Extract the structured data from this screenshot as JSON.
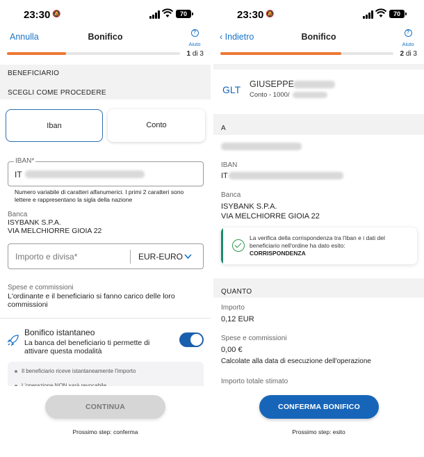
{
  "status": {
    "time": "23:30",
    "battery": "70"
  },
  "left": {
    "nav": {
      "left": "Annulla",
      "title": "Bonifico",
      "help": "Aiuto"
    },
    "progress": {
      "fraction": 0.34,
      "step": "1",
      "of": "di 3"
    },
    "beneficiario_label": "BENEFICIARIO",
    "choose_label": "SCEGLI COME PROCEDERE",
    "options": [
      {
        "label": "Iban",
        "selected": true
      },
      {
        "label": "Conto",
        "selected": false
      }
    ],
    "iban": {
      "label": "IBAN*",
      "prefix": "IT",
      "hint": "Numero variabile di caratteri alfanumerici. I primi 2 caratteri sono lettere e rappresentano la sigla della nazione"
    },
    "banca": {
      "label": "Banca",
      "name": "ISYBANK S.P.A.",
      "address": "VIA MELCHIORRE GIOIA 22"
    },
    "amount": {
      "placeholder": "Importo e divisa*",
      "currency": "EUR-EURO"
    },
    "spese": {
      "label": "Spese e commissioni",
      "text": "L'ordinante e il beneficiario si fanno carico delle loro commissioni"
    },
    "instant": {
      "title": "Bonifico istantaneo",
      "text": "La banca del beneficiario ti permette di attivare questa modalità",
      "on": true
    },
    "bullets": [
      "Il beneficiario riceve istantaneamente l'importo",
      "L'operazione NON sarà revocabile"
    ],
    "button": "CONTINUA",
    "next_step": "Prossimo step: conferma"
  },
  "right": {
    "nav": {
      "left": "Indietro",
      "title": "Bonifico",
      "help": "Aiuto"
    },
    "progress": {
      "fraction": 0.7,
      "step": "2",
      "of": "di 3"
    },
    "recipient": {
      "initials": "GLT",
      "name": "GIUSEPPE",
      "account_prefix": "Conto - 1000/"
    },
    "a_label": "A",
    "iban": {
      "label": "IBAN",
      "prefix": "IT"
    },
    "banca": {
      "label": "Banca",
      "name": "ISYBANK S.P.A.",
      "address": "VIA MELCHIORRE GIOIA 22"
    },
    "verify": {
      "text": "La verifica della corrispondenza tra l'iban e i dati del beneficiario nell'ordine ha dato esito:",
      "result": "CORRISPONDENZA"
    },
    "quanto_label": "QUANTO",
    "importo": {
      "label": "Importo",
      "value": "0,12 EUR"
    },
    "spese": {
      "label": "Spese e commissioni",
      "value": "0,00 €",
      "note": "Calcolate alla data di esecuzione dell'operazione"
    },
    "totale_label": "Importo totale stimato",
    "button": "CONFERMA BONIFICO",
    "next_step": "Prossimo step: esito"
  },
  "colors": {
    "accent": "#1765b8",
    "progress": "#ec7833",
    "success": "#2e9a4a"
  }
}
